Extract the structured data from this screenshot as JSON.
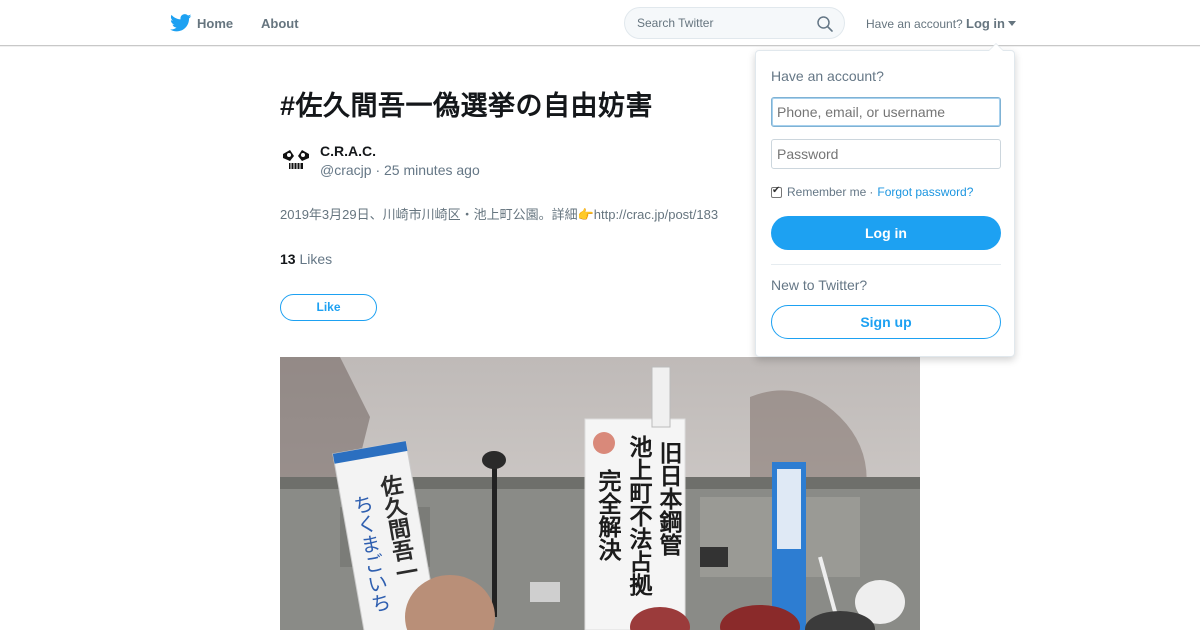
{
  "nav": {
    "home_label": "Home",
    "about_label": "About",
    "search_placeholder": "Search Twitter",
    "have_account": "Have an account?",
    "login_label": "Log in"
  },
  "tweet": {
    "title": "#佐久間吾一偽選挙の自由妨害",
    "author_name": "C.R.A.C.",
    "author_meta": "@cracjp · 25 minutes ago",
    "text": "2019年3月29日、川崎市川崎区・池上町公園。詳細👉http://crac.jp/post/183",
    "likes_count": "13",
    "likes_label": "Likes",
    "like_button": "Like",
    "photo_banner_main": [
      "旧日本鋼管",
      "池上町不法占拠",
      "完全解決"
    ],
    "photo_banner_left": [
      "佐久間吾一",
      "ちくまごいち"
    ]
  },
  "login_dropdown": {
    "heading": "Have an account?",
    "username_placeholder": "Phone, email, or username",
    "password_placeholder": "Password",
    "remember_me": "Remember me",
    "separator": "·",
    "forgot_password": "Forgot password?",
    "login_button": "Log in",
    "new_to_twitter": "New to Twitter?",
    "signup_button": "Sign up"
  },
  "colors": {
    "brand": "#1da1f2",
    "link": "#1b95e0",
    "muted": "#657786"
  }
}
